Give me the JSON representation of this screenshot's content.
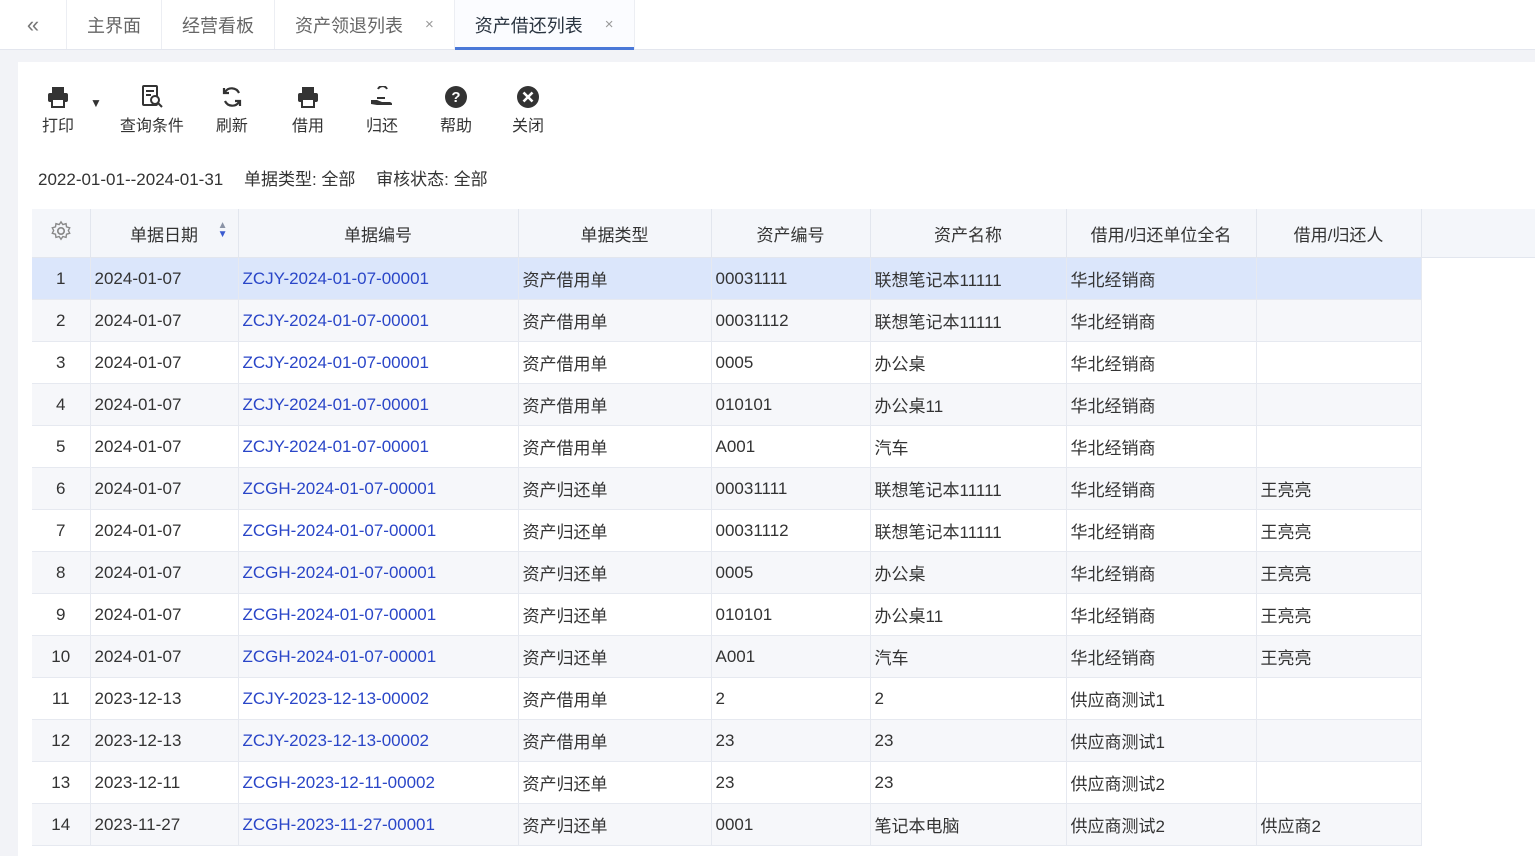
{
  "tabs": {
    "collapse_icon": "double-chevron-left-icon",
    "items": [
      {
        "label": "主界面",
        "closable": false
      },
      {
        "label": "经营看板",
        "closable": false
      },
      {
        "label": "资产领退列表",
        "closable": true
      },
      {
        "label": "资产借还列表",
        "closable": true,
        "active": true
      }
    ],
    "close_glyph": "×"
  },
  "toolbar": {
    "print": "打印",
    "query": "查询条件",
    "refresh": "刷新",
    "borrow": "借用",
    "return": "归还",
    "help": "帮助",
    "close": "关闭"
  },
  "filter": {
    "date_range": "2022-01-01--2024-01-31",
    "doc_type": "单据类型: 全部",
    "audit_status": "审核状态: 全部"
  },
  "table": {
    "columns": [
      "单据日期",
      "单据编号",
      "单据类型",
      "资产编号",
      "资产名称",
      "借用/归还单位全名",
      "借用/归还人"
    ],
    "rows": [
      [
        "1",
        "2024-01-07",
        "ZCJY-2024-01-07-00001",
        "资产借用单",
        "00031111",
        "联想笔记本11111",
        "华北经销商",
        ""
      ],
      [
        "2",
        "2024-01-07",
        "ZCJY-2024-01-07-00001",
        "资产借用单",
        "00031112",
        "联想笔记本11111",
        "华北经销商",
        ""
      ],
      [
        "3",
        "2024-01-07",
        "ZCJY-2024-01-07-00001",
        "资产借用单",
        "0005",
        "办公桌",
        "华北经销商",
        ""
      ],
      [
        "4",
        "2024-01-07",
        "ZCJY-2024-01-07-00001",
        "资产借用单",
        "010101",
        "办公桌11",
        "华北经销商",
        ""
      ],
      [
        "5",
        "2024-01-07",
        "ZCJY-2024-01-07-00001",
        "资产借用单",
        "A001",
        "汽车",
        "华北经销商",
        ""
      ],
      [
        "6",
        "2024-01-07",
        "ZCGH-2024-01-07-00001",
        "资产归还单",
        "00031111",
        "联想笔记本11111",
        "华北经销商",
        "王亮亮"
      ],
      [
        "7",
        "2024-01-07",
        "ZCGH-2024-01-07-00001",
        "资产归还单",
        "00031112",
        "联想笔记本11111",
        "华北经销商",
        "王亮亮"
      ],
      [
        "8",
        "2024-01-07",
        "ZCGH-2024-01-07-00001",
        "资产归还单",
        "0005",
        "办公桌",
        "华北经销商",
        "王亮亮"
      ],
      [
        "9",
        "2024-01-07",
        "ZCGH-2024-01-07-00001",
        "资产归还单",
        "010101",
        "办公桌11",
        "华北经销商",
        "王亮亮"
      ],
      [
        "10",
        "2024-01-07",
        "ZCGH-2024-01-07-00001",
        "资产归还单",
        "A001",
        "汽车",
        "华北经销商",
        "王亮亮"
      ],
      [
        "11",
        "2023-12-13",
        "ZCJY-2023-12-13-00002",
        "资产借用单",
        "2",
        "2",
        "供应商测试1",
        ""
      ],
      [
        "12",
        "2023-12-13",
        "ZCJY-2023-12-13-00002",
        "资产借用单",
        "23",
        "23",
        "供应商测试1",
        ""
      ],
      [
        "13",
        "2023-12-11",
        "ZCGH-2023-12-11-00002",
        "资产归还单",
        "23",
        "23",
        "供应商测试2",
        ""
      ],
      [
        "14",
        "2023-11-27",
        "ZCGH-2023-11-27-00001",
        "资产归还单",
        "0001",
        "笔记本电脑",
        "供应商测试2",
        "供应商2"
      ]
    ],
    "selected_row": 0
  },
  "colors": {
    "link": "#2a46c8",
    "selected_row": "#dbe6fb",
    "active_tab_underline": "#4a78d8"
  }
}
